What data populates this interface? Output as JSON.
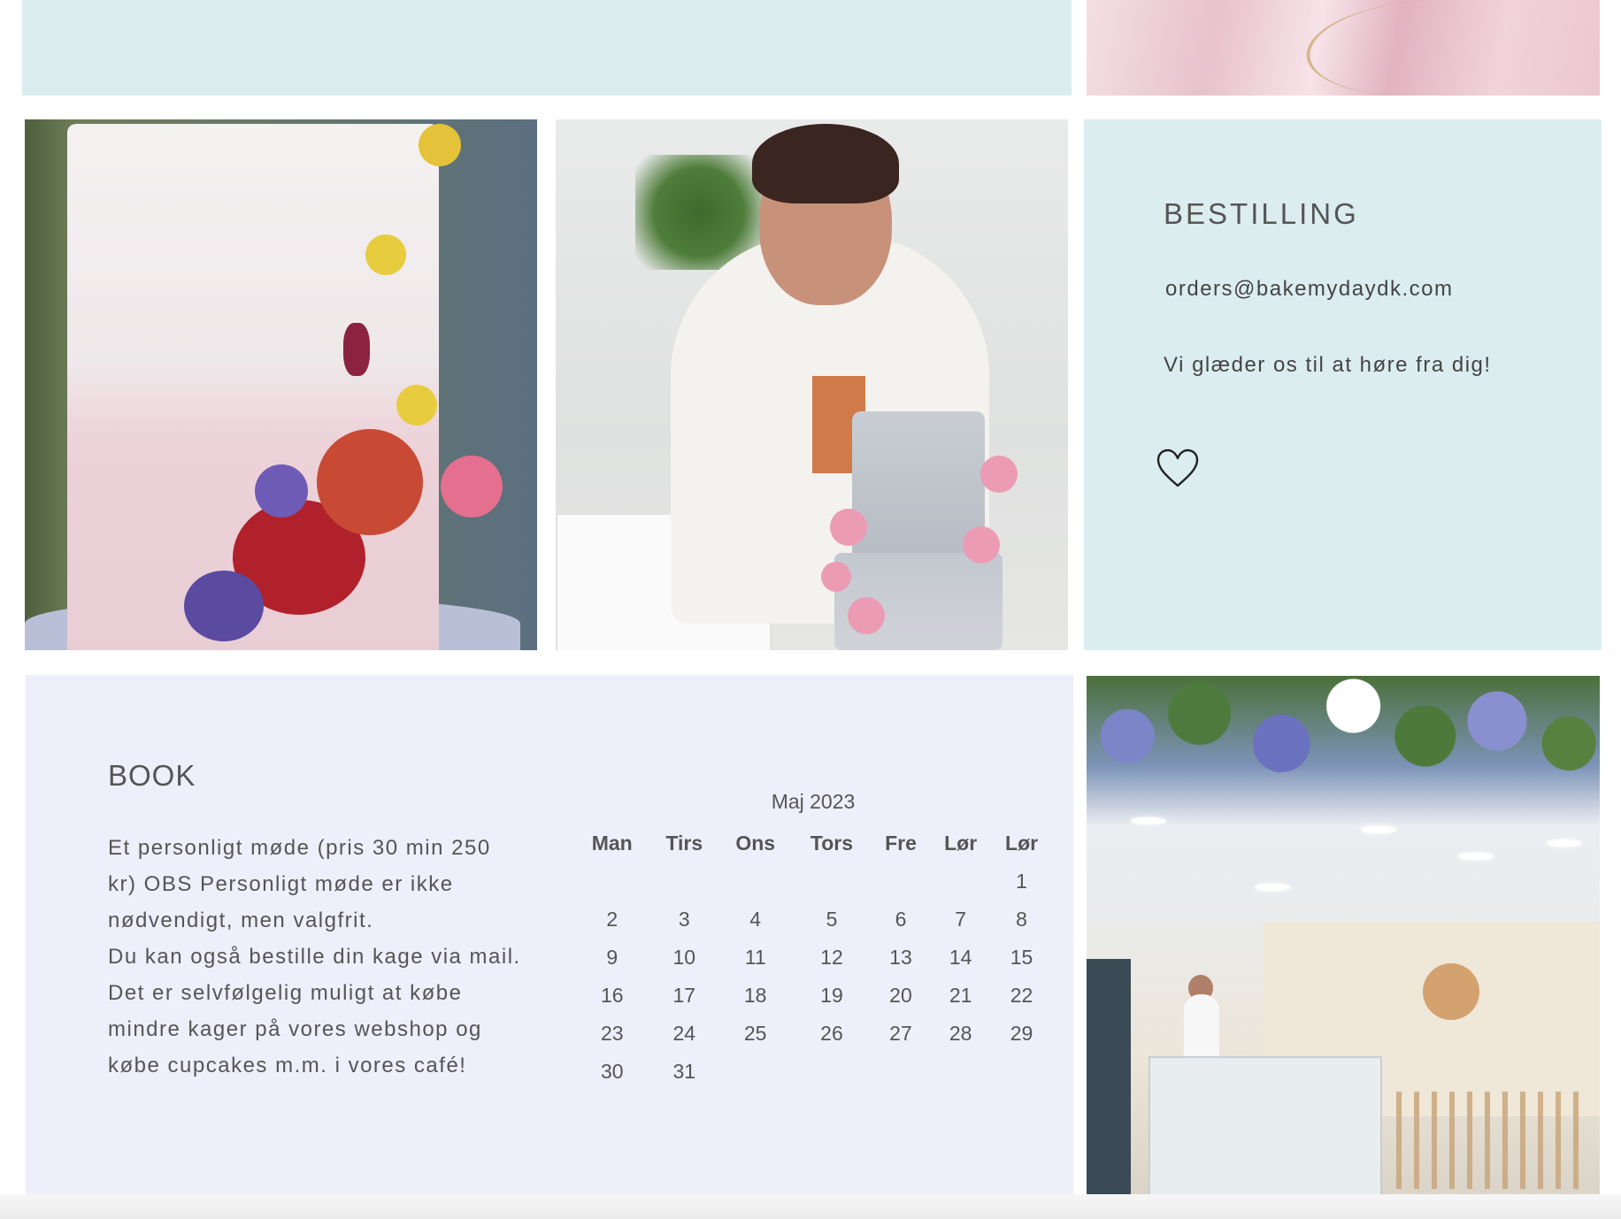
{
  "bestilling": {
    "heading": "BESTILLING",
    "email": "orders@bakemydaydk.com",
    "tagline": "Vi glæder os til at høre fra dig!",
    "icon": "heart-icon"
  },
  "book": {
    "heading": "BOOK",
    "paragraph1": "Et personligt møde (pris 30 min 250 kr) OBS Personligt møde er ikke nødvendigt, men valgfrit.",
    "paragraph2": "Du kan også bestille din kage via mail. Det er selvfølgelig muligt at købe mindre kager på vores webshop og købe cupcakes m.m. i vores café!"
  },
  "calendar": {
    "month": "Maj 2023",
    "weekdays": [
      "Man",
      "Tirs",
      "Ons",
      "Tors",
      "Fre",
      "Lør",
      "Lør"
    ],
    "weeks": [
      [
        "",
        "",
        "",
        "",
        "",
        "",
        "1"
      ],
      [
        "2",
        "3",
        "4",
        "5",
        "6",
        "7",
        "8"
      ],
      [
        "9",
        "10",
        "11",
        "12",
        "13",
        "14",
        "15"
      ],
      [
        "16",
        "17",
        "18",
        "19",
        "20",
        "21",
        "22"
      ],
      [
        "23",
        "24",
        "25",
        "26",
        "27",
        "28",
        "29"
      ],
      [
        "30",
        "31",
        "",
        "",
        "",
        "",
        ""
      ]
    ]
  },
  "colors": {
    "light_blue_panel": "#dcedf0",
    "lavender_panel": "#efeefb",
    "text": "#555555"
  }
}
